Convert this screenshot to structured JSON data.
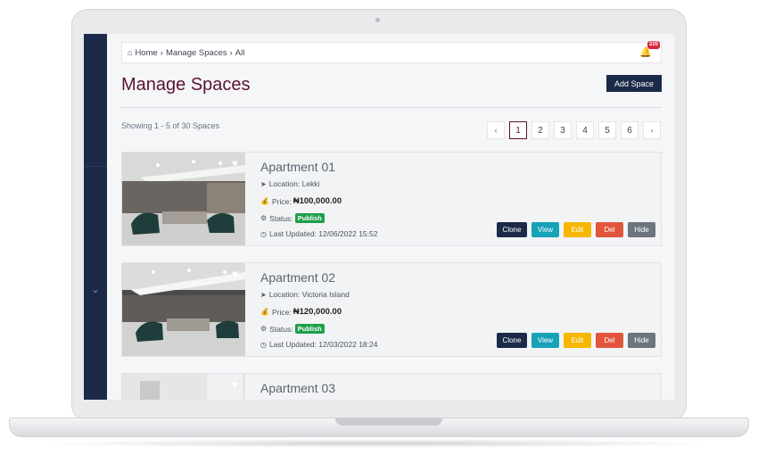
{
  "breadcrumb": {
    "home": "Home",
    "section": "Manage Spaces",
    "current": "All"
  },
  "notifications": {
    "count": "225"
  },
  "page_title": "Manage Spaces",
  "add_space_label": "Add Space",
  "showing_text": "Showing 1 - 5 of 30 Spaces",
  "pagination": {
    "prev": "‹",
    "next": "›",
    "pages": [
      "1",
      "2",
      "3",
      "4",
      "5",
      "6"
    ],
    "active": "1"
  },
  "listings": [
    {
      "title": "Apartment 01",
      "location_label": "Location:",
      "location": "Lekki",
      "price_label": "Price:",
      "price": "₦100,000.00",
      "status_label": "Status:",
      "status": "Publish",
      "updated_label": "Last Updated:",
      "updated": "12/06/2022 15:52"
    },
    {
      "title": "Apartment 02",
      "location_label": "Location:",
      "location": "Victoria Island",
      "price_label": "Price:",
      "price": "₦120,000.00",
      "status_label": "Status:",
      "status": "Publish",
      "updated_label": "Last Updated:",
      "updated": "12/03/2022 18:24"
    },
    {
      "title": "Apartment 03"
    }
  ],
  "actions": {
    "clone": "Clone",
    "view": "View",
    "edit": "Edit",
    "del": "Del",
    "hide": "Hide"
  },
  "colors": {
    "sidebar": "#1b2a49",
    "title": "#5a1330",
    "publish": "#1e9e4a",
    "view": "#17a2b8",
    "edit": "#f5b700",
    "del": "#e2553c",
    "hide": "#6c757d"
  }
}
